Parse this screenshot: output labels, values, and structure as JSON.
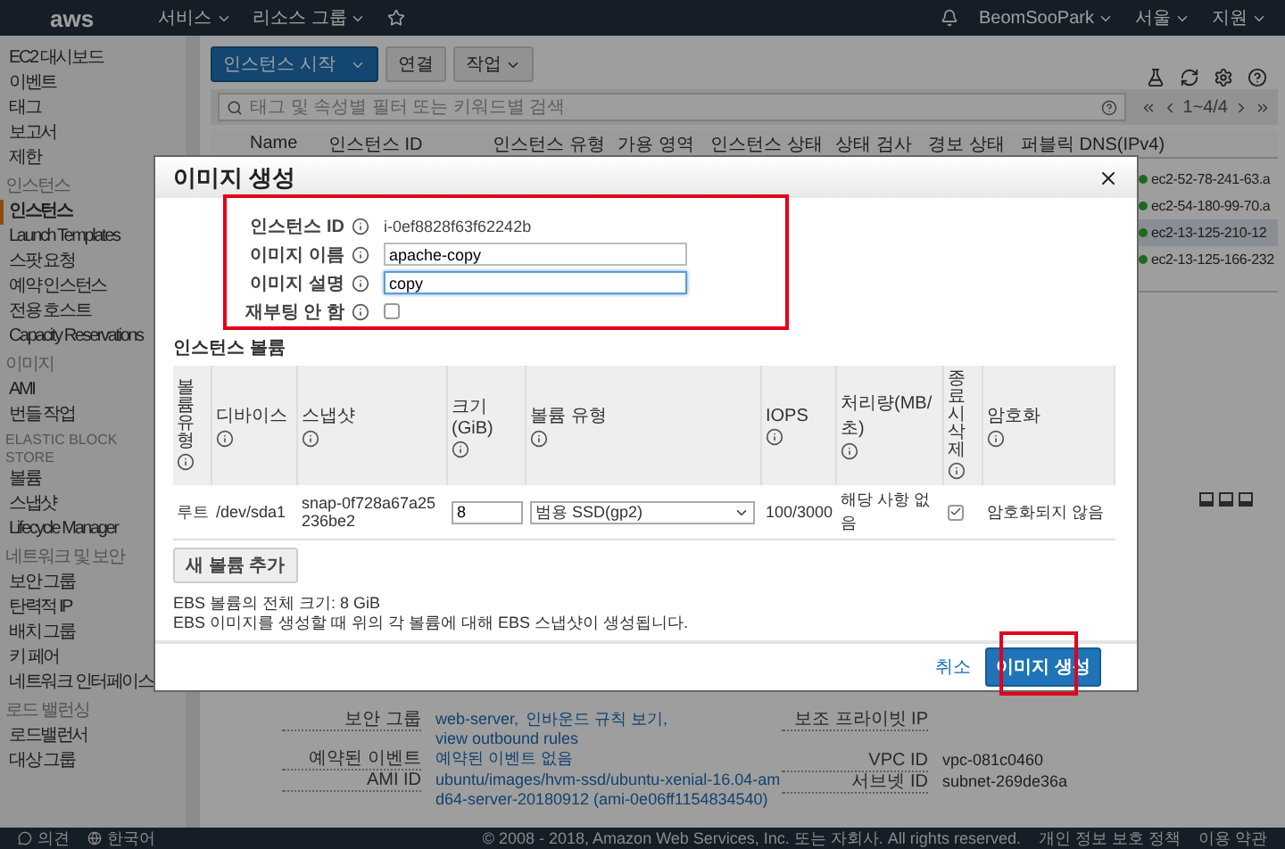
{
  "top_bar": {
    "logo": "aws",
    "menus": [
      {
        "label": "서비스"
      },
      {
        "label": "리소스 그룹"
      }
    ],
    "user": "BeomSooPark",
    "region": "서울",
    "support": "지원"
  },
  "sidebar": {
    "items": [
      {
        "kind": "link",
        "label": "EC2 대시보드",
        "selected": false
      },
      {
        "kind": "link",
        "label": "이벤트",
        "selected": false
      },
      {
        "kind": "link",
        "label": "태그",
        "selected": false
      },
      {
        "kind": "link",
        "label": "보고서",
        "selected": false
      },
      {
        "kind": "link",
        "label": "제한",
        "selected": false
      },
      {
        "kind": "section",
        "label": "인스턴스",
        "selected": false
      },
      {
        "kind": "link",
        "label": "인스턴스",
        "selected": true
      },
      {
        "kind": "link",
        "label": "Launch Templates",
        "selected": false
      },
      {
        "kind": "link",
        "label": "스팟 요청",
        "selected": false
      },
      {
        "kind": "link",
        "label": "예약 인스턴스",
        "selected": false
      },
      {
        "kind": "link",
        "label": "전용 호스트",
        "selected": false
      },
      {
        "kind": "link",
        "label": "Capacity Reservations",
        "selected": false
      },
      {
        "kind": "section",
        "label": "이미지",
        "selected": false
      },
      {
        "kind": "link",
        "label": "AMI",
        "selected": false
      },
      {
        "kind": "link",
        "label": "번들 작업",
        "selected": false
      },
      {
        "kind": "section",
        "label": "ELASTIC BLOCK STORE",
        "selected": false
      },
      {
        "kind": "link",
        "label": "볼륨",
        "selected": false
      },
      {
        "kind": "link",
        "label": "스냅샷",
        "selected": false
      },
      {
        "kind": "link",
        "label": "Lifecycle Manager",
        "selected": false
      },
      {
        "kind": "section",
        "label": "네트워크 및 보안",
        "selected": false
      },
      {
        "kind": "link",
        "label": "보안 그룹",
        "selected": false
      },
      {
        "kind": "link",
        "label": "탄력적 IP",
        "selected": false
      },
      {
        "kind": "link",
        "label": "배치 그룹",
        "selected": false
      },
      {
        "kind": "link",
        "label": "키 페어",
        "selected": false
      },
      {
        "kind": "link",
        "label": "네트워크 인터페이스",
        "selected": false
      },
      {
        "kind": "section",
        "label": "로드 밸런싱",
        "selected": false
      },
      {
        "kind": "link",
        "label": "로드밸런서",
        "selected": false
      },
      {
        "kind": "link",
        "label": "대상 그룹",
        "selected": false
      }
    ]
  },
  "toolbar": {
    "launch_button": "인스턴스 시작",
    "connect_button": "연결",
    "actions_button": "작업"
  },
  "search": {
    "placeholder": "태그 및 속성별 필터 또는 키워드별 검색",
    "pager": "1~4/4"
  },
  "table": {
    "columns": [
      "Name",
      "인스턴스 ID",
      "인스턴스 유형",
      "가용 영역",
      "인스턴스 상태",
      "상태 검사",
      "경보 상태",
      "퍼블릭 DNS(IPv4)"
    ],
    "rows": [
      {
        "public_dns": "ec2-52-78-241-63.a",
        "selected": false
      },
      {
        "public_dns": "ec2-54-180-99-70.a",
        "selected": false
      },
      {
        "public_dns": "ec2-13-125-210-12",
        "selected": true
      },
      {
        "public_dns": "ec2-13-125-166-232",
        "selected": false
      }
    ]
  },
  "details": {
    "left": [
      {
        "label": "보안 그룹",
        "links": [
          "web-server,",
          "인바운드 규칙 보기,",
          "view outbound rules"
        ]
      },
      {
        "label": "예약된 이벤트",
        "links": [
          "예약된 이벤트 없음"
        ]
      },
      {
        "label": "AMI ID",
        "links": [
          "ubuntu/images/hvm-ssd/ubuntu-xenial-16.04-amd64-server-20180912 (ami-0e06ff1154834540)"
        ]
      }
    ],
    "right": [
      {
        "label": "보조 프라이빗 IP"
      },
      {
        "label": "VPC ID",
        "value": "vpc-081c0460"
      },
      {
        "label": "서브넷 ID",
        "value": "subnet-269de36a"
      }
    ]
  },
  "modal": {
    "title": "이미지 생성",
    "highlight_form": true,
    "highlight_create": true,
    "fields": [
      {
        "kind": "text",
        "label": "인스턴스 ID",
        "value": "i-0ef8828f63f62242b"
      },
      {
        "kind": "input",
        "label": "이미지 이름",
        "value": "apache-copy",
        "focused": false
      },
      {
        "kind": "input",
        "label": "이미지 설명",
        "value": "copy",
        "focused": true
      },
      {
        "kind": "checkbox",
        "label": "재부팅 안 함",
        "checked": false
      }
    ],
    "volumes_title": "인스턴스 볼륨",
    "volume_columns": [
      "볼륨 유형",
      "디바이스",
      "스냅샷",
      "크기(GiB)",
      "볼륨 유형",
      "IOPS",
      "처리량(MB/초)",
      "종료 시 삭제",
      "암호화"
    ],
    "volumes": [
      {
        "type": "루트",
        "device": "/dev/sda1",
        "snapshot": "snap-0f728a67a25236be2",
        "size": "8",
        "volume_type": "범용 SSD(gp2)",
        "iops": "100/3000",
        "throughput": "해당 사항 없음",
        "delete_on_termination": true,
        "encryption": "암호화되지 않음"
      }
    ],
    "add_button": "새 볼륨 추가",
    "notes": [
      "EBS 볼륨의 전체 크기: 8 GiB",
      "EBS 이미지를 생성할 때 위의 각 볼륨에 대해 EBS 스냅샷이 생성됩니다."
    ],
    "cancel": "취소",
    "create_button": "이미지 생성"
  },
  "footer": {
    "feedback": "의견",
    "language": "한국어",
    "copyright": "© 2008 - 2018, Amazon Web Services, Inc. 또는 자회사. All rights reserved.",
    "privacy": "개인 정보 보호 정책",
    "terms": "이용 약관"
  }
}
